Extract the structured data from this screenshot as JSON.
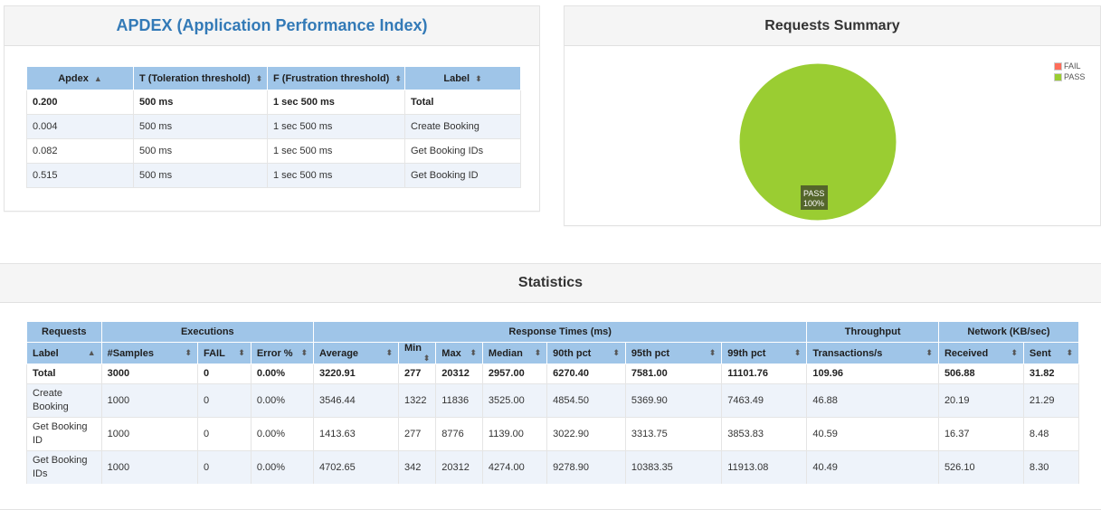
{
  "apdex": {
    "title": "APDEX (Application Performance Index)",
    "columns": [
      {
        "label": "Apdex",
        "sort": "▲"
      },
      {
        "label": "T (Toleration threshold)",
        "sort": "⬍"
      },
      {
        "label": "F (Frustration threshold)",
        "sort": "⬍"
      },
      {
        "label": "Label",
        "sort": "⬍"
      }
    ],
    "rows": [
      [
        "0.200",
        "500 ms",
        "1 sec 500 ms",
        "Total"
      ],
      [
        "0.004",
        "500 ms",
        "1 sec 500 ms",
        "Create Booking"
      ],
      [
        "0.082",
        "500 ms",
        "1 sec 500 ms",
        "Get Booking IDs"
      ],
      [
        "0.515",
        "500 ms",
        "1 sec 500 ms",
        "Get Booking ID"
      ]
    ]
  },
  "summary": {
    "title": "Requests Summary",
    "legend": [
      {
        "label": "FAIL",
        "color": "#ff6d5a"
      },
      {
        "label": "PASS",
        "color": "#9acd32"
      }
    ],
    "slice_label": "PASS",
    "slice_percent": "100%",
    "chart_data": {
      "type": "pie",
      "categories": [
        "FAIL",
        "PASS"
      ],
      "values": [
        0,
        100
      ]
    }
  },
  "stats": {
    "title": "Statistics",
    "groups": [
      {
        "label": "Requests",
        "span": 1
      },
      {
        "label": "Executions",
        "span": 3
      },
      {
        "label": "Response Times (ms)",
        "span": 7
      },
      {
        "label": "Throughput",
        "span": 1
      },
      {
        "label": "Network (KB/sec)",
        "span": 2
      }
    ],
    "columns": [
      {
        "label": "Label",
        "sort": "▲"
      },
      {
        "label": "#Samples",
        "sort": "⬍"
      },
      {
        "label": "FAIL",
        "sort": "⬍"
      },
      {
        "label": "Error %",
        "sort": "⬍"
      },
      {
        "label": "Average",
        "sort": "⬍"
      },
      {
        "label": "Min",
        "sort": "⬍"
      },
      {
        "label": "Max",
        "sort": "⬍"
      },
      {
        "label": "Median",
        "sort": "⬍"
      },
      {
        "label": "90th pct",
        "sort": "⬍"
      },
      {
        "label": "95th pct",
        "sort": "⬍"
      },
      {
        "label": "99th pct",
        "sort": "⬍"
      },
      {
        "label": "Transactions/s",
        "sort": "⬍"
      },
      {
        "label": "Received",
        "sort": "⬍"
      },
      {
        "label": "Sent",
        "sort": "⬍"
      }
    ],
    "rows": [
      [
        "Total",
        "3000",
        "0",
        "0.00%",
        "3220.91",
        "277",
        "20312",
        "2957.00",
        "6270.40",
        "7581.00",
        "11101.76",
        "109.96",
        "506.88",
        "31.82"
      ],
      [
        "Create Booking",
        "1000",
        "0",
        "0.00%",
        "3546.44",
        "1322",
        "11836",
        "3525.00",
        "4854.50",
        "5369.90",
        "7463.49",
        "46.88",
        "20.19",
        "21.29"
      ],
      [
        "Get Booking ID",
        "1000",
        "0",
        "0.00%",
        "1413.63",
        "277",
        "8776",
        "1139.00",
        "3022.90",
        "3313.75",
        "3853.83",
        "40.59",
        "16.37",
        "8.48"
      ],
      [
        "Get Booking IDs",
        "1000",
        "0",
        "0.00%",
        "4702.65",
        "342",
        "20312",
        "4274.00",
        "9278.90",
        "10383.35",
        "11913.08",
        "40.49",
        "526.10",
        "8.30"
      ]
    ]
  }
}
